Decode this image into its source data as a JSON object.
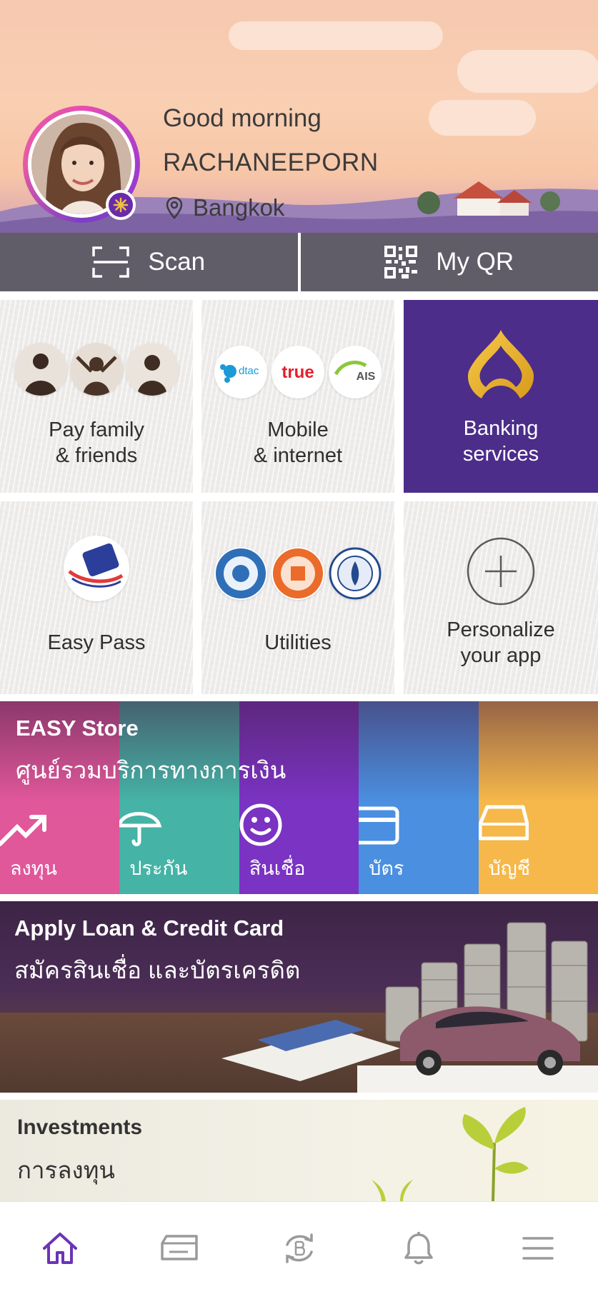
{
  "header": {
    "greeting": "Good morning",
    "user_name": "RACHANEEPORN",
    "location": "Bangkok",
    "avatar_badge_icon": "sparkle-icon",
    "location_icon": "map-pin-icon"
  },
  "quick_actions": {
    "scan_label": "Scan",
    "scan_icon": "scan-frame-icon",
    "myqr_label": "My QR",
    "myqr_icon": "qr-code-icon"
  },
  "tiles": [
    {
      "line1": "Pay family",
      "line2": "& friends",
      "icon": "people-photos-icon"
    },
    {
      "line1": "Mobile",
      "line2": "& internet",
      "logos": [
        "dtac",
        "true",
        "AIS"
      ]
    },
    {
      "line1": "Banking",
      "line2": "services",
      "icon": "scb-logo-icon"
    },
    {
      "line1": "Easy Pass",
      "icon": "easy-pass-logo-icon"
    },
    {
      "line1": "Utilities",
      "icon": "utility-seals-icon"
    },
    {
      "line1": "Personalize",
      "line2": "your app",
      "icon": "plus-circle-icon"
    }
  ],
  "easy_store": {
    "title": "EASY Store",
    "subtitle": "ศูนย์รวมบริการทางการเงิน",
    "categories": [
      {
        "label": "ลงทุน",
        "icon": "trend-up-icon",
        "color": "#e0579a"
      },
      {
        "label": "ประกัน",
        "icon": "umbrella-icon",
        "color": "#45b3a6"
      },
      {
        "label": "สินเชื่อ",
        "icon": "smile-icon",
        "color": "#7a33c2"
      },
      {
        "label": "บัตร",
        "icon": "card-icon",
        "color": "#4a8fe0"
      },
      {
        "label": "บัญชี",
        "icon": "passbook-icon",
        "color": "#f6b84a"
      }
    ]
  },
  "loan_banner": {
    "title": "Apply Loan & Credit Card",
    "subtitle": "สมัครสินเชื่อ และบัตรเครดิต"
  },
  "investments_banner": {
    "title": "Investments",
    "subtitle": "การลงทุน"
  },
  "bottom_nav": [
    {
      "name": "home",
      "icon": "home-icon",
      "active": true
    },
    {
      "name": "accounts",
      "icon": "wallet-card-icon",
      "active": false
    },
    {
      "name": "transfer",
      "icon": "baht-transfer-icon",
      "active": false
    },
    {
      "name": "notifications",
      "icon": "bell-icon",
      "active": false
    },
    {
      "name": "menu",
      "icon": "hamburger-menu-icon",
      "active": false
    }
  ],
  "colors": {
    "brand_purple": "#4c2d8a",
    "active_nav": "#6a35b5",
    "inactive_nav": "#9a9a9a",
    "scanbar_bg": "#605d69"
  }
}
